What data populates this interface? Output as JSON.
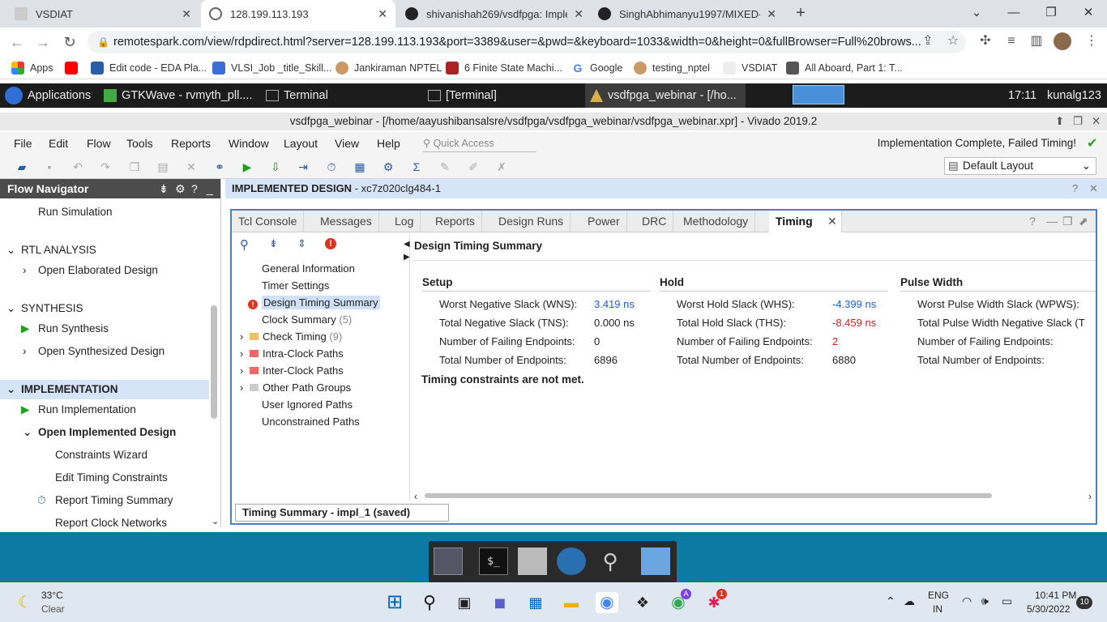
{
  "browser": {
    "tabs": [
      {
        "title": "VSDIAT",
        "active": false
      },
      {
        "title": "128.199.113.193",
        "active": true
      },
      {
        "title": "shivanishah269/vsdfpga: Implem",
        "active": false
      },
      {
        "title": "SinghAbhimanyu1997/MIXED-SIG",
        "active": false
      }
    ],
    "new_tab": "+",
    "url": "remotespark.com/view/rdpdirect.html?server=128.199.113.193&port=3389&user=&pwd=&keyboard=1033&width=0&height=0&fullBrowser=Full%20brows...",
    "bookmarks": [
      "Apps",
      "Edit code - EDA Pla...",
      "VLSI_Job _title_Skill...",
      "Jankiraman NPTEL",
      "6 Finite State Machi...",
      "Google",
      "testing_nptel",
      "VSDIAT",
      "All Aboard, Part 1: T..."
    ]
  },
  "xfce_panel": {
    "applications": "Applications",
    "tasks": [
      "GTKWave - rvmyth_pll....",
      "Terminal",
      "[Terminal]",
      "vsdfpga_webinar - [/ho..."
    ],
    "clock": "17:11",
    "user": "kunalg123"
  },
  "vivado": {
    "title": "vsdfpga_webinar - [/home/aayushibansalsre/vsdfpga/vsdfpga_webinar/vsdfpga_webinar.xpr] - Vivado 2019.2",
    "menu": [
      "File",
      "Edit",
      "Flow",
      "Tools",
      "Reports",
      "Window",
      "Layout",
      "View",
      "Help"
    ],
    "quick_access": "Quick Access",
    "status": "Implementation Complete, Failed Timing!",
    "layout": "Default Layout",
    "flow_navigator": {
      "title": "Flow Navigator",
      "items": [
        {
          "label": "Run Simulation"
        },
        {
          "label": "RTL ANALYSIS"
        },
        {
          "label": "Open Elaborated Design"
        },
        {
          "label": "SYNTHESIS"
        },
        {
          "label": "Run Synthesis"
        },
        {
          "label": "Open Synthesized Design"
        },
        {
          "label": "IMPLEMENTATION"
        },
        {
          "label": "Run Implementation"
        },
        {
          "label": "Open Implemented Design"
        },
        {
          "label": "Constraints Wizard"
        },
        {
          "label": "Edit Timing Constraints"
        },
        {
          "label": "Report Timing Summary"
        },
        {
          "label": "Report Clock Networks"
        }
      ]
    },
    "impl_header": {
      "title": "IMPLEMENTED DESIGN",
      "part": " - xc7z020clg484-1"
    },
    "panel_tabs": [
      "Tcl Console",
      "Messages",
      "Log",
      "Reports",
      "Design Runs",
      "Power",
      "DRC",
      "Methodology",
      "Timing"
    ],
    "tree": [
      {
        "label": "General Information"
      },
      {
        "label": "Timer Settings"
      },
      {
        "label": "Design Timing Summary"
      },
      {
        "label": "Clock Summary",
        "count": "(5)"
      },
      {
        "label": "Check Timing",
        "count": "(9)"
      },
      {
        "label": "Intra-Clock Paths"
      },
      {
        "label": "Inter-Clock Paths"
      },
      {
        "label": "Other Path Groups"
      },
      {
        "label": "User Ignored Paths"
      },
      {
        "label": "Unconstrained Paths"
      }
    ],
    "summary": {
      "title": "Design Timing Summary",
      "setup": {
        "heading": "Setup",
        "rows": [
          {
            "label": "Worst Negative Slack (WNS):",
            "value": "3.419 ns"
          },
          {
            "label": "Total Negative Slack (TNS):",
            "value": "0.000 ns"
          },
          {
            "label": "Number of Failing Endpoints:",
            "value": "0"
          },
          {
            "label": "Total Number of Endpoints:",
            "value": "6896"
          }
        ]
      },
      "hold": {
        "heading": "Hold",
        "rows": [
          {
            "label": "Worst Hold Slack (WHS):",
            "value": "-4.399 ns"
          },
          {
            "label": "Total Hold Slack (THS):",
            "value": "-8.459 ns"
          },
          {
            "label": "Number of Failing Endpoints:",
            "value": "2"
          },
          {
            "label": "Total Number of Endpoints:",
            "value": "6880"
          }
        ]
      },
      "pulse": {
        "heading": "Pulse Width",
        "rows": [
          {
            "label": "Worst Pulse Width Slack (WPWS):"
          },
          {
            "label": "Total Pulse Width Negative Slack (T"
          },
          {
            "label": "Number of Failing Endpoints:"
          },
          {
            "label": "Total Number of Endpoints:"
          }
        ]
      },
      "message": "Timing constraints are not met."
    },
    "bottom_tab": "Timing Summary - impl_1 (saved)"
  },
  "taskbar": {
    "weather_temp": "33°C",
    "weather_desc": "Clear",
    "lang": "ENG",
    "region": "IN",
    "time": "10:41 PM",
    "date": "5/30/2022",
    "notif_count": "10",
    "slack_badge": "1",
    "profile_badge": "A"
  },
  "colors": {
    "link_blue": "#1a5fd0",
    "fail_red": "#d21f1f",
    "panel_border": "#4a7fc7"
  }
}
